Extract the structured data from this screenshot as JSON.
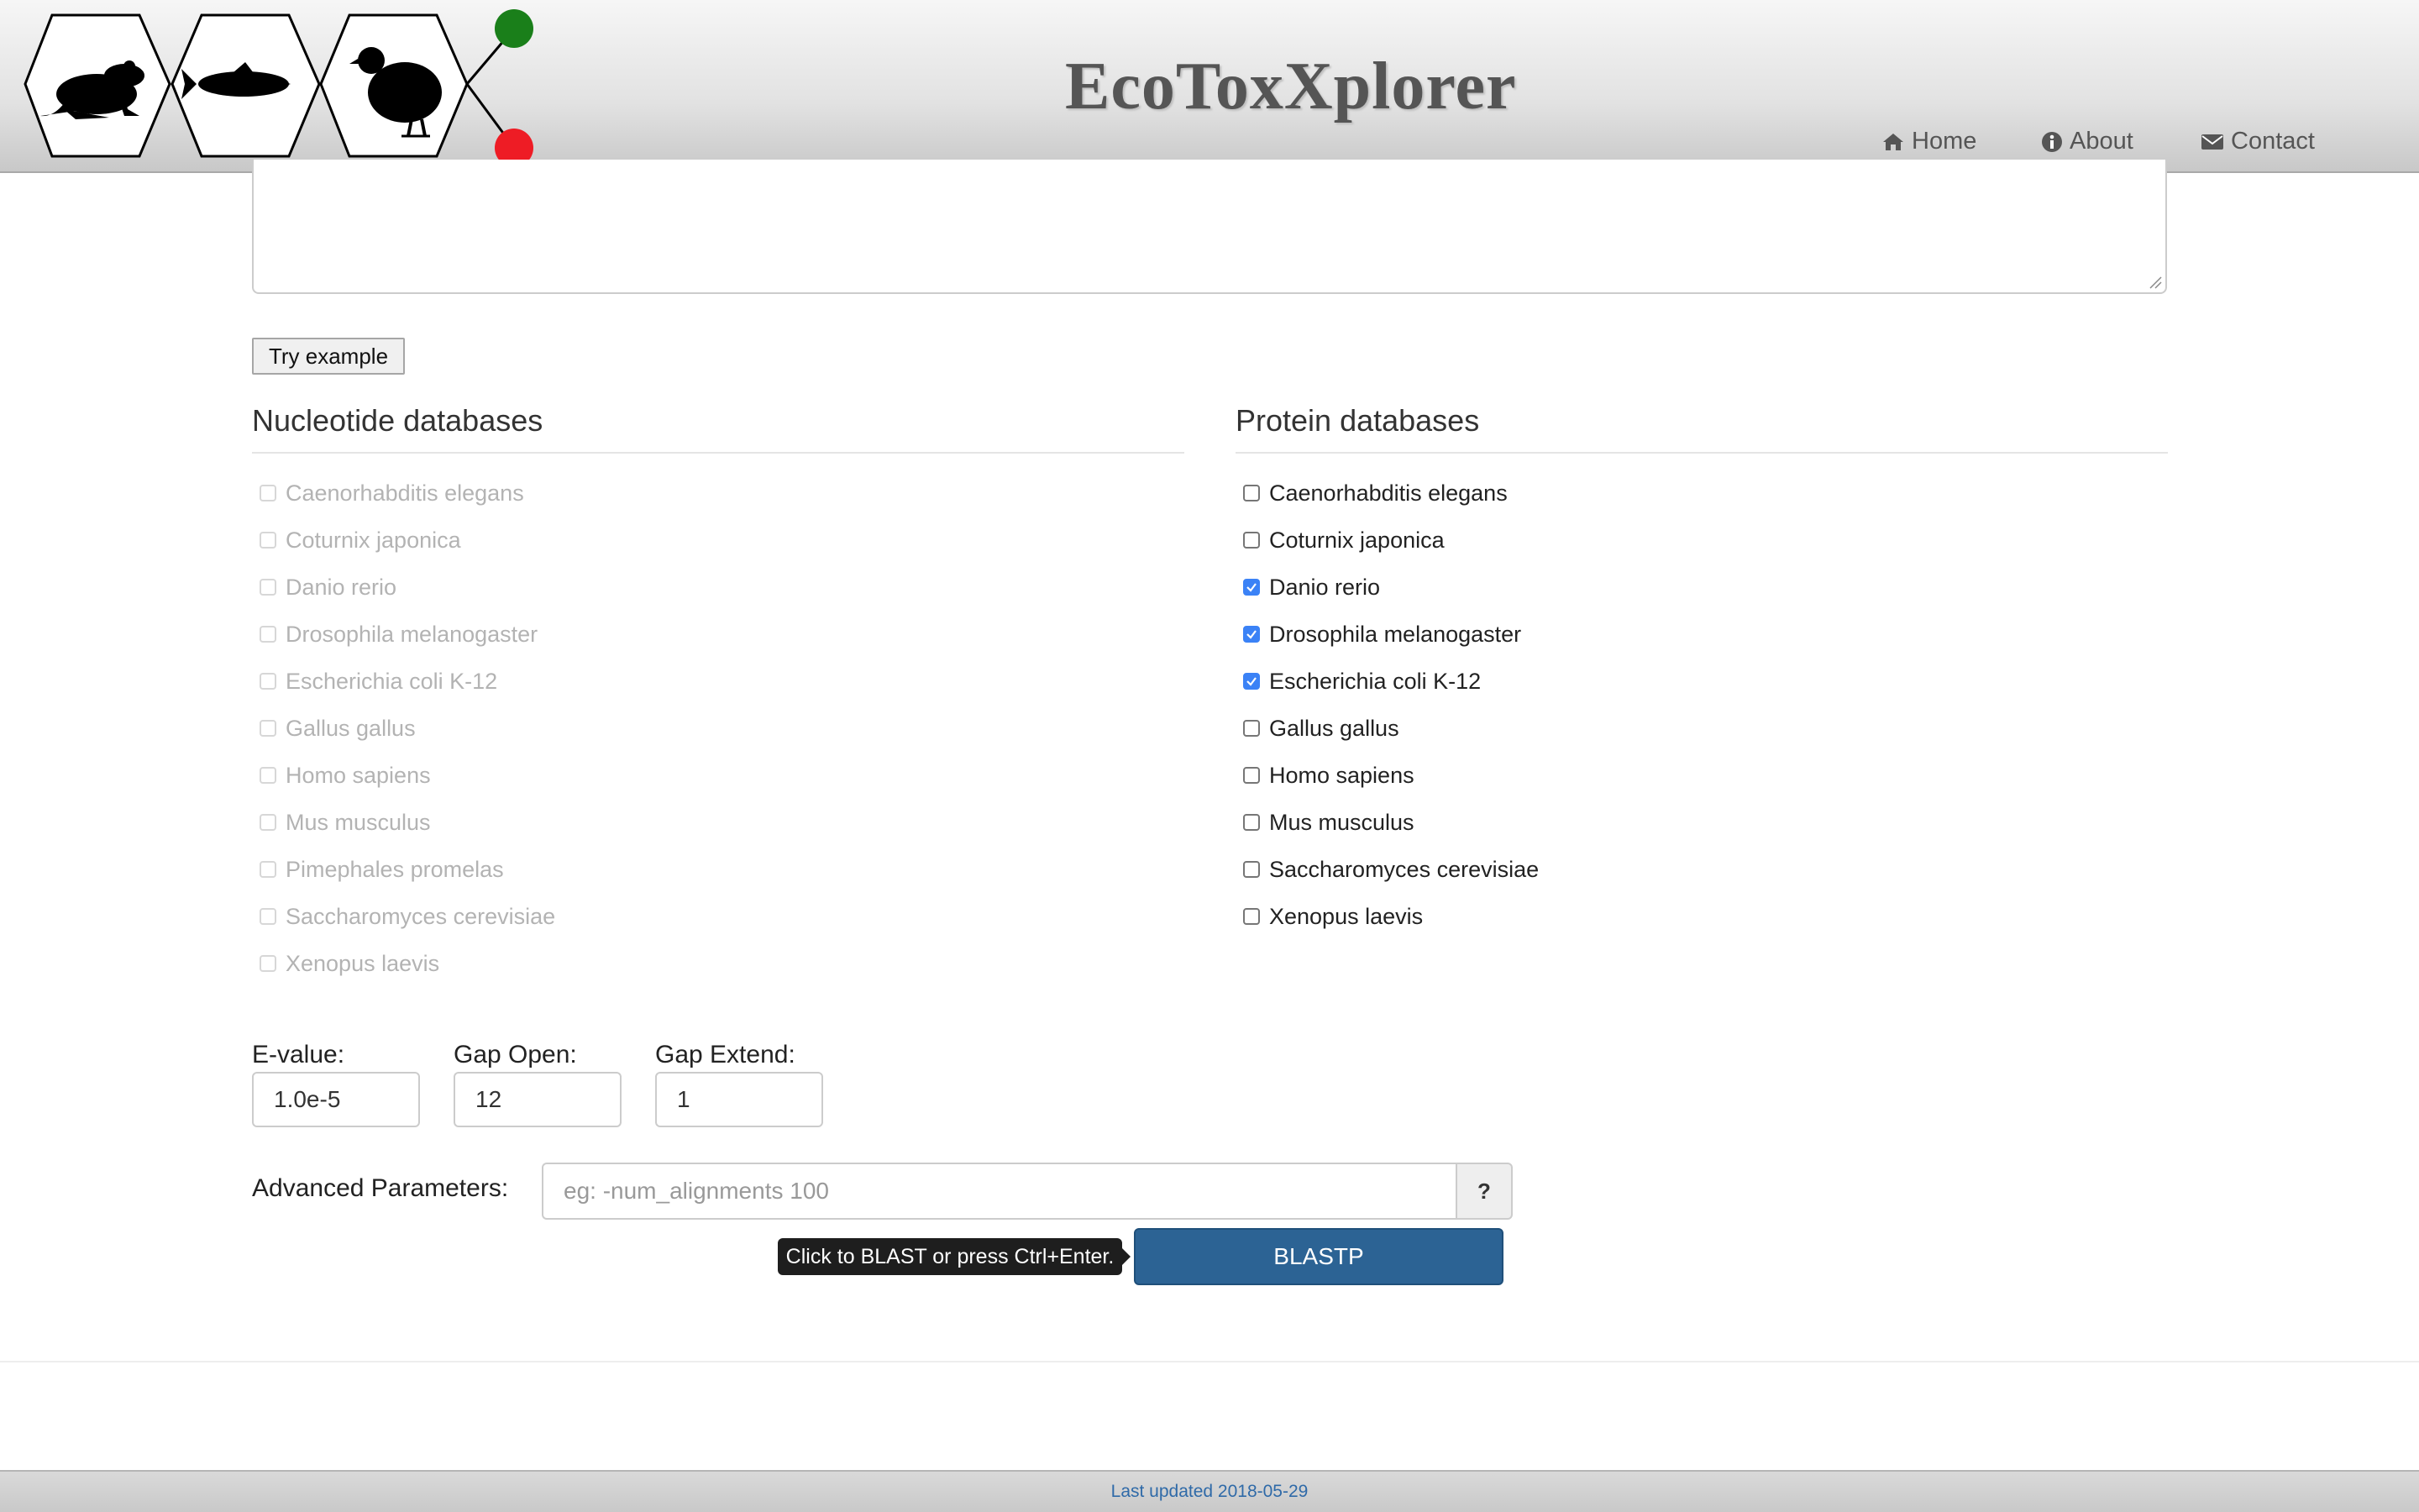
{
  "app": {
    "title": "EcoToxXplorer"
  },
  "nav": {
    "home": "Home",
    "about": "About",
    "contact": "Contact"
  },
  "icons": {
    "logo": [
      "frog-icon",
      "fish-icon",
      "quail-icon"
    ],
    "status": {
      "green": "#1a7f1a",
      "red": "#ee1c25"
    }
  },
  "form": {
    "try_example": "Try example",
    "nucleotide": {
      "heading": "Nucleotide databases",
      "items": [
        {
          "label": "Caenorhabditis elegans",
          "checked": false,
          "disabled": true
        },
        {
          "label": "Coturnix japonica",
          "checked": false,
          "disabled": true
        },
        {
          "label": "Danio rerio",
          "checked": false,
          "disabled": true
        },
        {
          "label": "Drosophila melanogaster",
          "checked": false,
          "disabled": true
        },
        {
          "label": "Escherichia coli K-12",
          "checked": false,
          "disabled": true
        },
        {
          "label": "Gallus gallus",
          "checked": false,
          "disabled": true
        },
        {
          "label": "Homo sapiens",
          "checked": false,
          "disabled": true
        },
        {
          "label": "Mus musculus",
          "checked": false,
          "disabled": true
        },
        {
          "label": "Pimephales promelas",
          "checked": false,
          "disabled": true
        },
        {
          "label": "Saccharomyces cerevisiae",
          "checked": false,
          "disabled": true
        },
        {
          "label": "Xenopus laevis",
          "checked": false,
          "disabled": true
        }
      ]
    },
    "protein": {
      "heading": "Protein databases",
      "items": [
        {
          "label": "Caenorhabditis elegans",
          "checked": false,
          "disabled": false
        },
        {
          "label": "Coturnix japonica",
          "checked": false,
          "disabled": false
        },
        {
          "label": "Danio rerio",
          "checked": true,
          "disabled": false
        },
        {
          "label": "Drosophila melanogaster",
          "checked": true,
          "disabled": false
        },
        {
          "label": "Escherichia coli K-12",
          "checked": true,
          "disabled": false
        },
        {
          "label": "Gallus gallus",
          "checked": false,
          "disabled": false
        },
        {
          "label": "Homo sapiens",
          "checked": false,
          "disabled": false
        },
        {
          "label": "Mus musculus",
          "checked": false,
          "disabled": false
        },
        {
          "label": "Saccharomyces cerevisiae",
          "checked": false,
          "disabled": false
        },
        {
          "label": "Xenopus laevis",
          "checked": false,
          "disabled": false
        }
      ]
    },
    "params": {
      "evalue": {
        "label": "E-value:",
        "value": "1.0e-5"
      },
      "gap_open": {
        "label": "Gap Open:",
        "value": "12"
      },
      "gap_extend": {
        "label": "Gap Extend:",
        "value": "1"
      }
    },
    "advanced": {
      "label": "Advanced Parameters:",
      "placeholder": "eg: -num_alignments 100",
      "help": "?"
    },
    "tooltip": "Click to BLAST or press Ctrl+Enter.",
    "submit": "BLASTP",
    "accent": "#2c6394"
  },
  "footer": {
    "text": "Last updated 2018-05-29"
  }
}
